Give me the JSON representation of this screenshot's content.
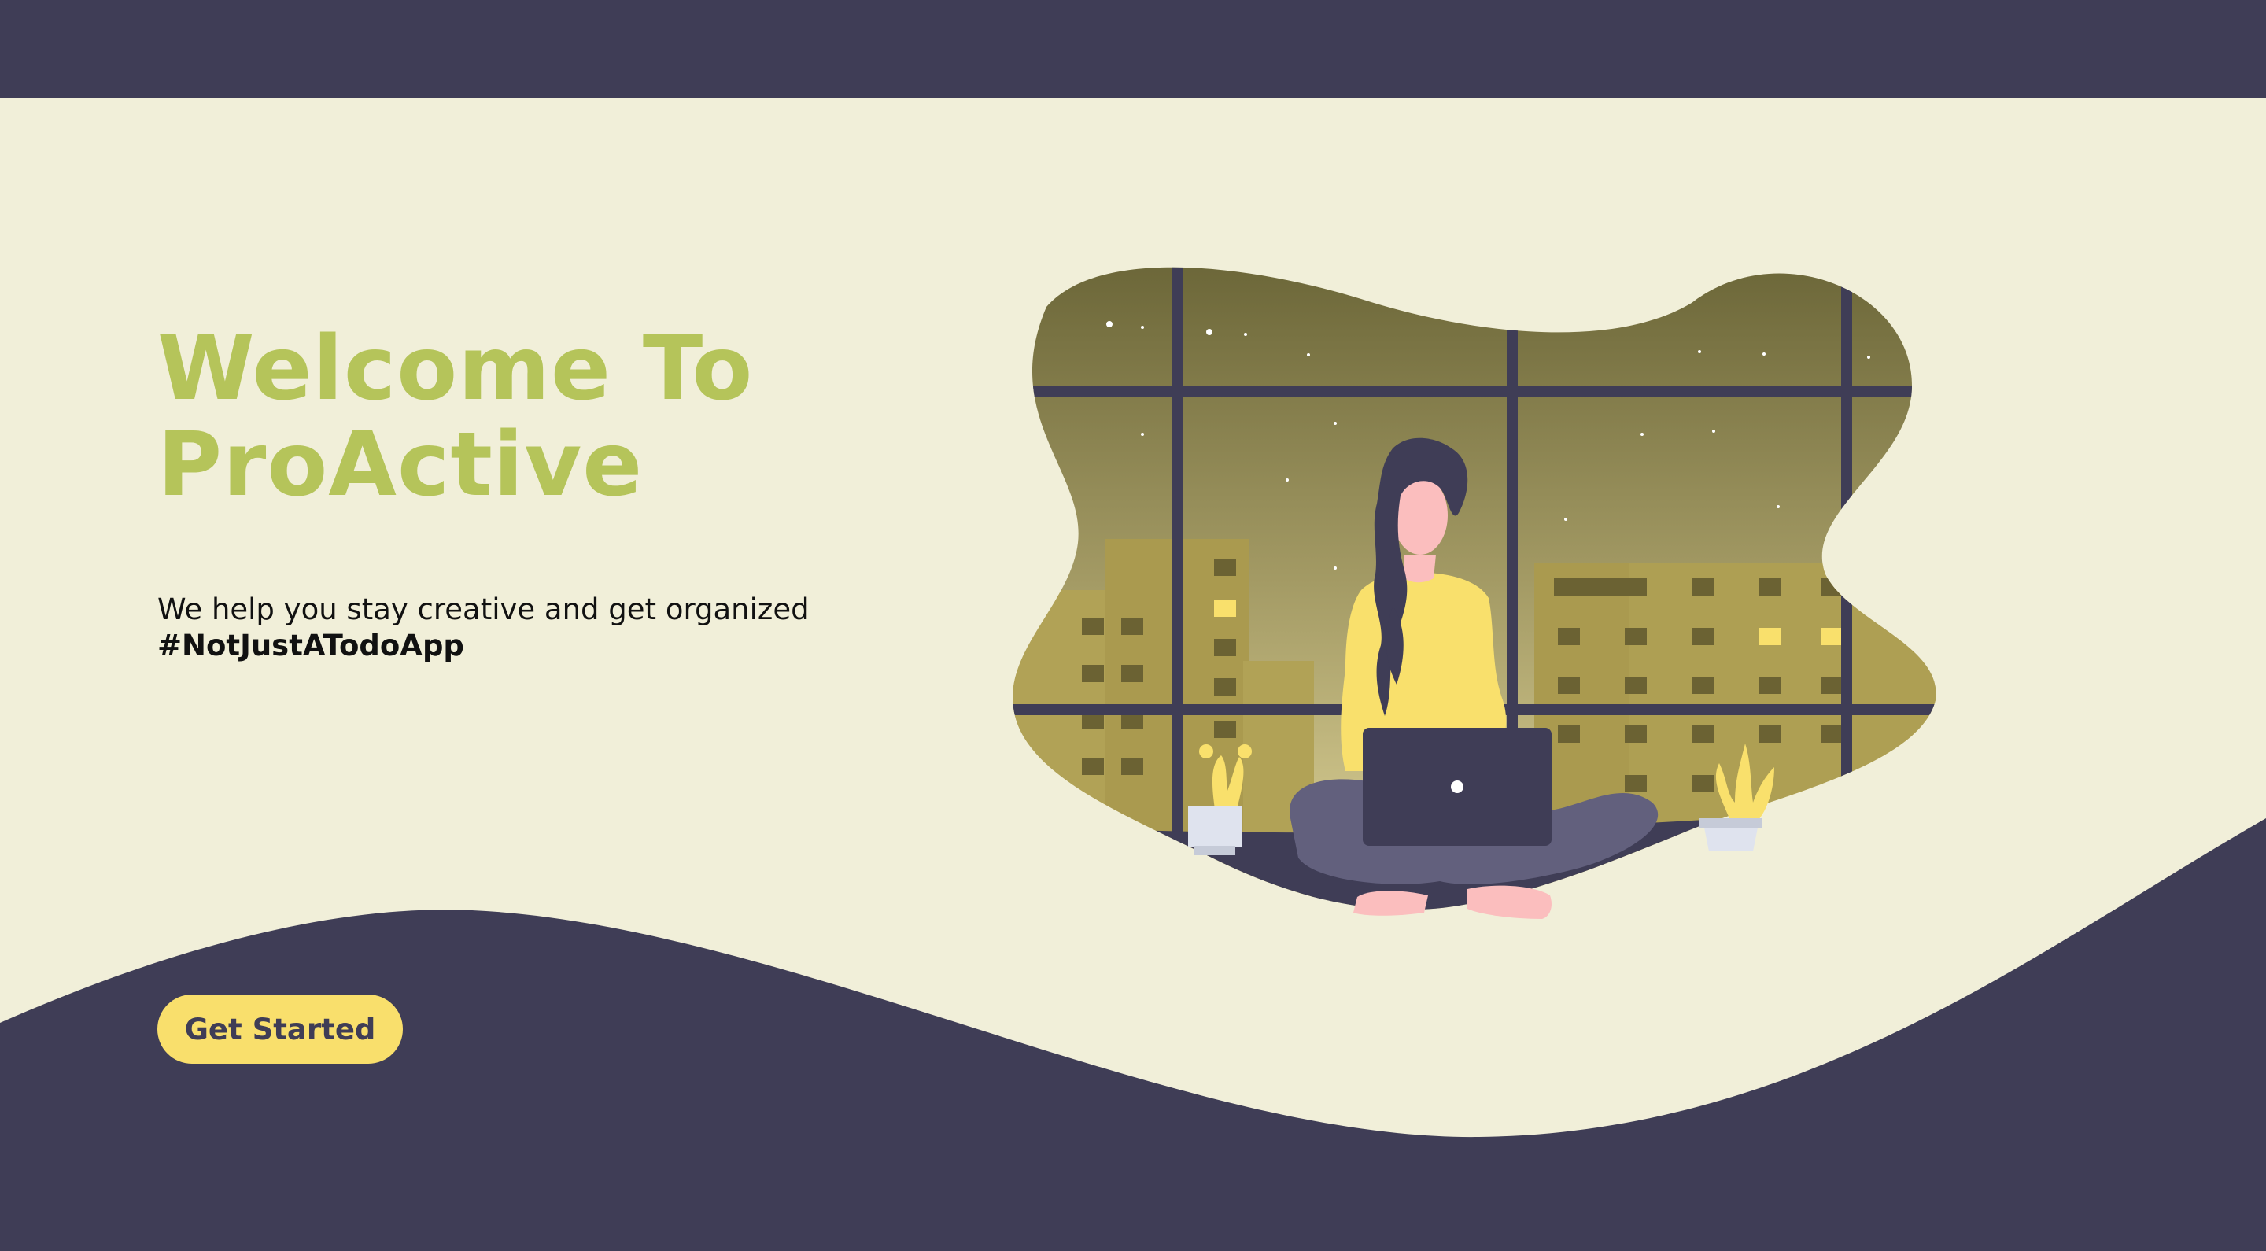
{
  "hero": {
    "title_line1": "Welcome To",
    "title_line2": "ProActive",
    "tagline": "We help you stay creative and get organized",
    "hashtag": "#NotJustATodoApp"
  },
  "cta": {
    "label": "Get Started"
  },
  "colors": {
    "navy": "#3f3d56",
    "cream": "#f1efd9",
    "title_green": "#b5c45a",
    "button_yellow": "#f9df6c",
    "sweater_yellow": "#f9e06c",
    "pants_purple": "#62607d",
    "skin_pink": "#fbbebe"
  },
  "illustration": {
    "subject": "woman-with-laptop-at-window-icon"
  }
}
